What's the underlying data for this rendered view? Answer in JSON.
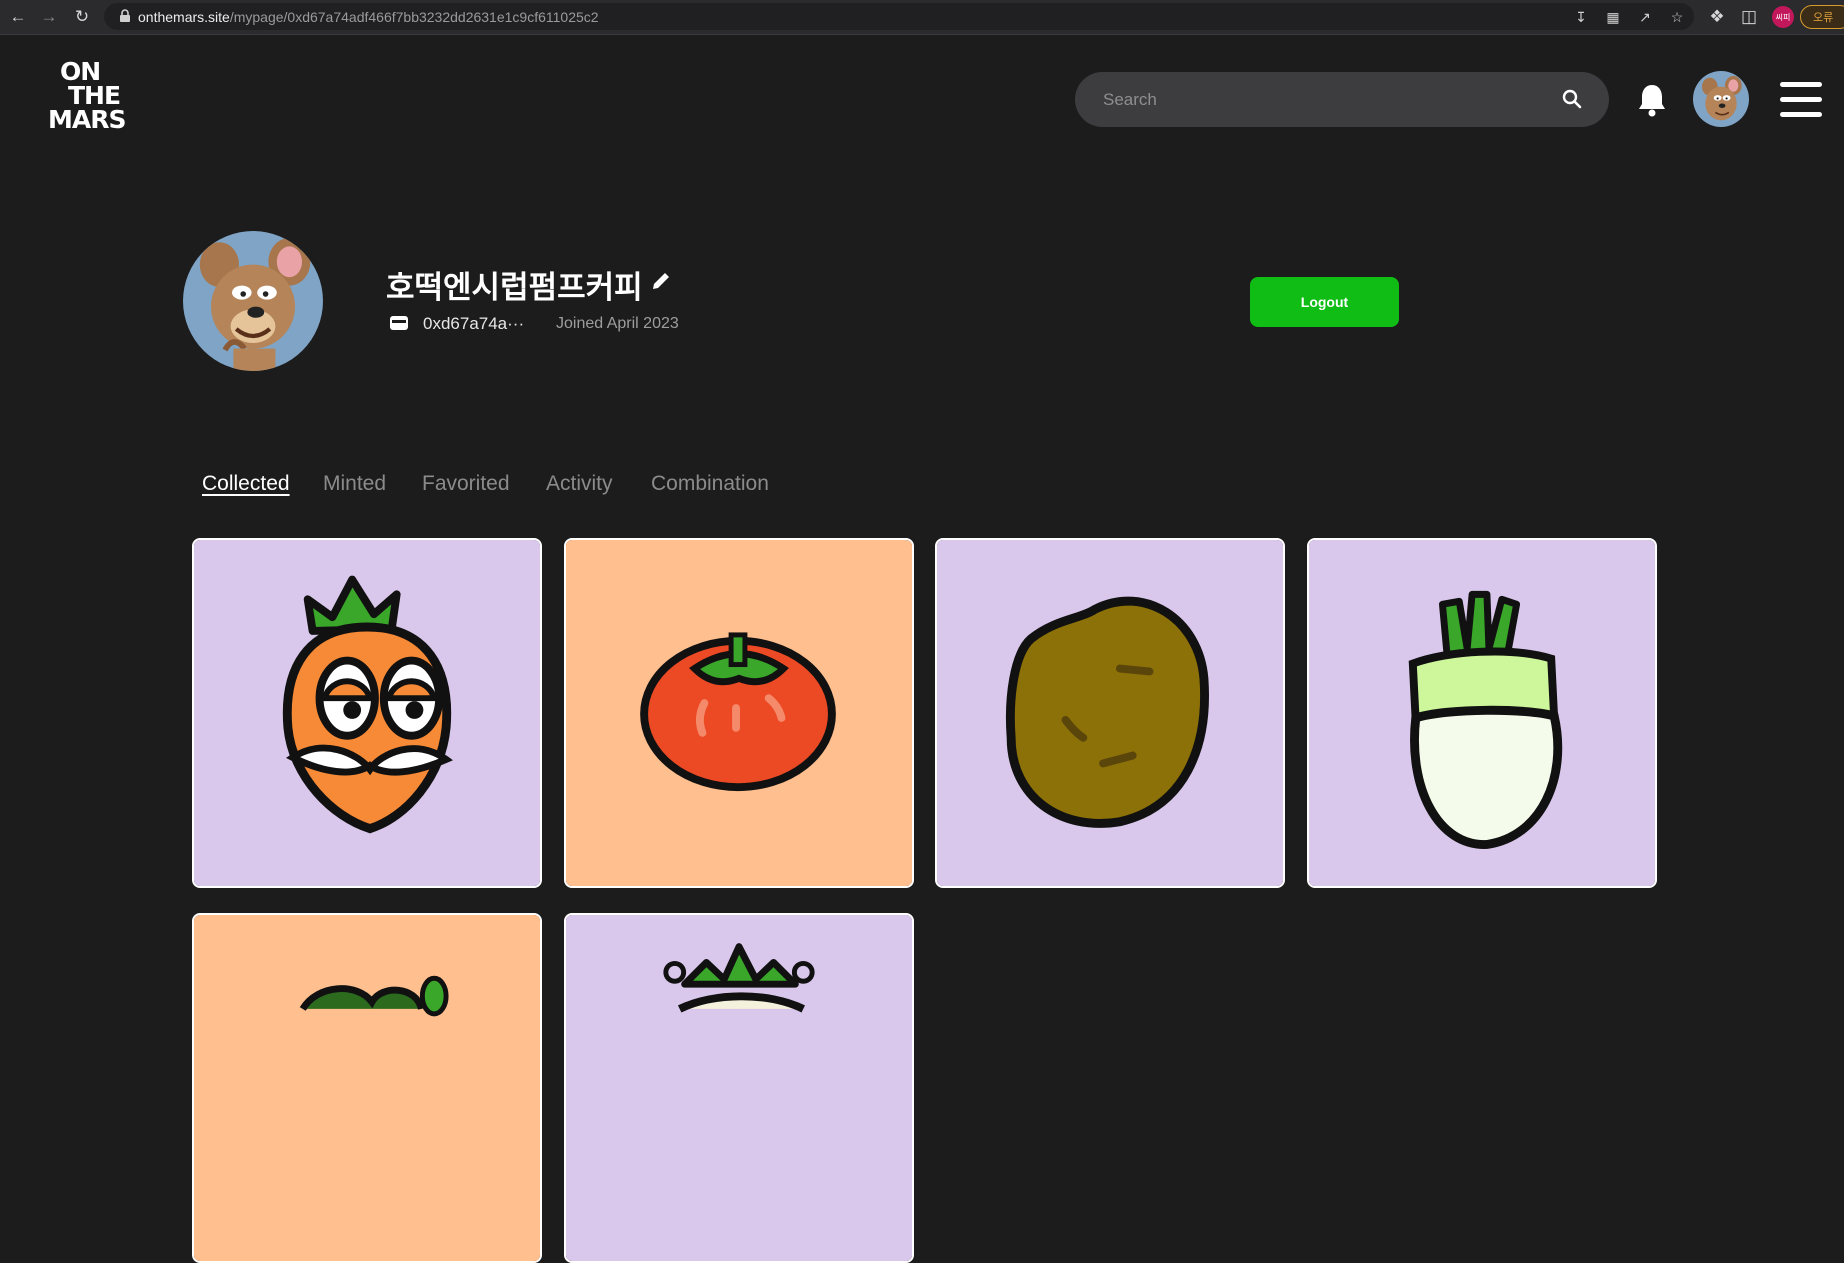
{
  "browser": {
    "url_host": "onthemars.site",
    "url_path": "/mypage/0xd67a74adf466f7bb3232dd2631e1c9cf611025c2",
    "profile_initials": "씨피",
    "extension_label": "오류"
  },
  "header": {
    "logo": [
      "ON",
      "THE",
      "MARS"
    ],
    "search_placeholder": "Search"
  },
  "profile": {
    "username": "호떡엔시럽펌프커피",
    "wallet_short": "0xd67a74a···",
    "joined": "Joined April 2023",
    "logout_label": "Logout"
  },
  "tabs": [
    {
      "label": "Collected",
      "active": true
    },
    {
      "label": "Minted",
      "active": false
    },
    {
      "label": "Favorited",
      "active": false
    },
    {
      "label": "Activity",
      "active": false
    },
    {
      "label": "Combination",
      "active": false
    }
  ],
  "nfts": [
    {
      "name": "carrot",
      "bg": "#dac8ec"
    },
    {
      "name": "tomato",
      "bg": "#ffbf8f"
    },
    {
      "name": "potato",
      "bg": "#dac8ec"
    },
    {
      "name": "radish",
      "bg": "#dac8ec"
    },
    {
      "name": "plant",
      "bg": "#ffbf8f"
    },
    {
      "name": "onion",
      "bg": "#dac8ec"
    }
  ],
  "colors": {
    "background": "#1c1c1c",
    "accent_green": "#0fbd14",
    "lavender": "#dac8ec",
    "peach": "#ffbf8f"
  }
}
